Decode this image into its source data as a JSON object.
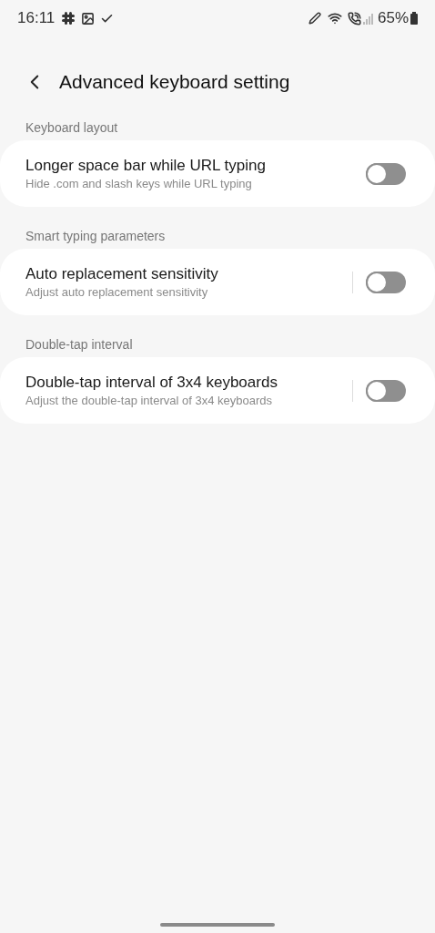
{
  "status_bar": {
    "time": "16:11",
    "battery": "65%"
  },
  "header": {
    "title": "Advanced keyboard setting"
  },
  "sections": [
    {
      "label": "Keyboard layout",
      "items": [
        {
          "title": "Longer space bar while URL typing",
          "subtitle": "Hide .com and slash keys while URL typing",
          "on": false,
          "divider": false
        }
      ]
    },
    {
      "label": "Smart typing parameters",
      "items": [
        {
          "title": "Auto replacement sensitivity",
          "subtitle": "Adjust auto replacement sensitivity",
          "on": false,
          "divider": true
        }
      ]
    },
    {
      "label": "Double-tap interval",
      "items": [
        {
          "title": "Double-tap interval of 3x4 keyboards",
          "subtitle": "Adjust the double-tap interval of 3x4 keyboards",
          "on": false,
          "divider": true
        }
      ]
    }
  ]
}
